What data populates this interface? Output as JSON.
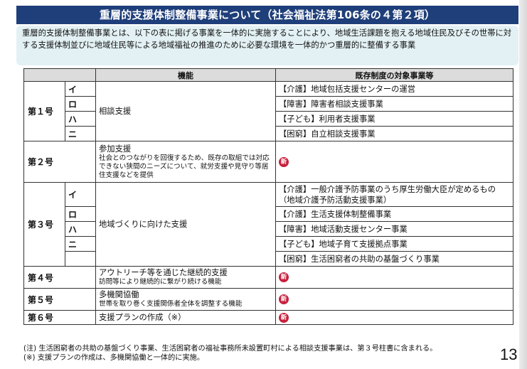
{
  "title": "重層的支援体制整備事業について（社会福祉法第106条の４第２項）",
  "intro": "重層的支援体制整備事業とは、以下の表に掲げる事業を一体的に実施することにより、地域生活課題を抱える地域住民及びその世帯に対する支援体制並びに地域住民等による地域福祉の推進のために必要な環境を一体的かつ重層的に整備する事業",
  "table": {
    "header_function": "機能",
    "header_existing": "既存制度の対象事業等",
    "new_badge": "新",
    "row1": {
      "num": "第１号",
      "function": "相談支援",
      "sub": [
        {
          "kana": "イ",
          "existing": "【介護】地域包括支援センターの運営"
        },
        {
          "kana": "ロ",
          "existing": "【障害】障害者相談支援事業"
        },
        {
          "kana": "ハ",
          "existing": "【子ども】利用者支援事業"
        },
        {
          "kana": "ニ",
          "existing": "【困窮】自立相談支援事業"
        }
      ]
    },
    "row2": {
      "num": "第２号",
      "function": "参加支援",
      "function_sub": "社会とのつながりを回復するため、既存の取組では対応できない狭間のニーズについて、就労支援や見守り等居住支援などを提供"
    },
    "row3": {
      "num": "第３号",
      "function": "地域づくりに向けた支援",
      "sub": [
        {
          "kana": "イ",
          "existing": "【介護】一般介護予防事業のうち厚生労働大臣が定めるもの（地域介護予防活動支援事業）"
        },
        {
          "kana": "ロ",
          "existing": "【介護】生活支援体制整備事業"
        },
        {
          "kana": "ハ",
          "existing": "【障害】地域活動支援センター事業"
        },
        {
          "kana": "ニ",
          "existing": "【子ども】地域子育て支援拠点事業"
        },
        {
          "kana": "",
          "existing": "【困窮】生活困窮者の共助の基盤づくり事業"
        }
      ]
    },
    "row4": {
      "num": "第４号",
      "function": "アウトリーチ等を通じた継続的支援",
      "function_sub": "訪問等により継続的に繋がり続ける機能"
    },
    "row5": {
      "num": "第５号",
      "function": "多機関協働",
      "function_sub": "世帯を取り巻く支援関係者全体を調整する機能"
    },
    "row6": {
      "num": "第６号",
      "function": "支援プランの作成（※）"
    }
  },
  "notes": [
    "(注) 生活困窮者の共助の基盤づくり事業、生活困窮者の福祉事務所未設置町村による相談支援事業は、第３号柱書に含まれる。",
    "(※) 支援プランの作成は、多機関協働と一体的に実施。"
  ],
  "page_number": "13"
}
